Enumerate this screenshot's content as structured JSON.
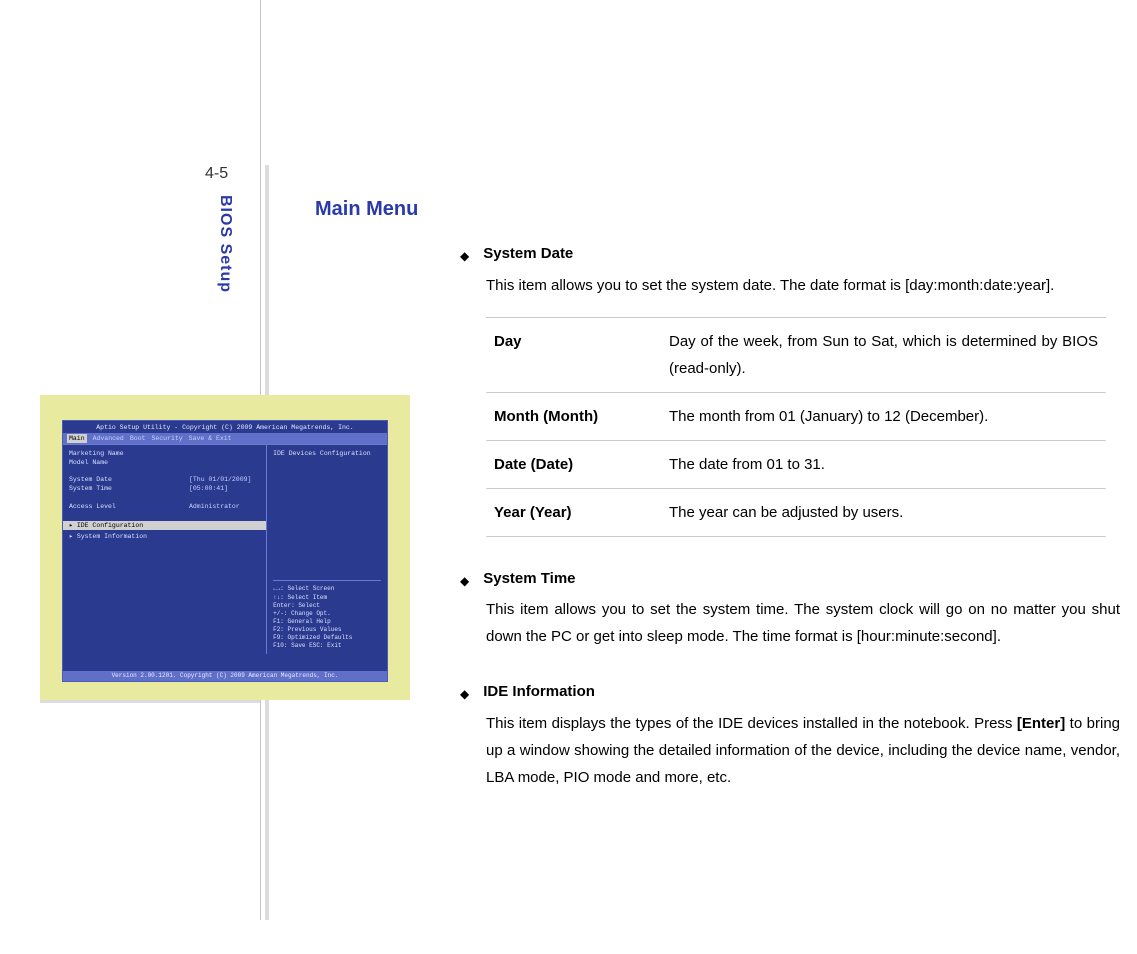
{
  "page_number": "4-5",
  "sidebar_label": "BIOS Setup",
  "heading": "Main Menu",
  "sections": {
    "system_date": {
      "title": "System Date",
      "body": "This item allows you to set the system date.   The date format is [day:month:date:year]."
    },
    "system_time": {
      "title": "System Time",
      "body": "This item allows you to set the system time.   The system clock will go on no matter you shut down the PC or get into sleep mode.   The time format is [hour:minute:second]."
    },
    "ide_info": {
      "title": "IDE Information",
      "body_pre": "This item displays the types of the IDE devices installed in the notebook. Press ",
      "body_bold": "[Enter]",
      "body_post": " to bring up a window showing the detailed information of the device, including the device name, vendor, LBA mode, PIO mode and more, etc."
    }
  },
  "date_rows": [
    {
      "term": "Day",
      "desc": "Day of the week, from Sun to Sat, which is determined by BIOS (read-only)."
    },
    {
      "term": "Month (Month)",
      "desc": "The month from 01 (January) to 12 (December)."
    },
    {
      "term": "Date (Date)",
      "desc": "The date from 01 to 31."
    },
    {
      "term": "Year (Year)",
      "desc": "The year can be adjusted by users."
    }
  ],
  "bios": {
    "title": "Aptio Setup Utility - Copyright (C) 2009 American Megatrends, Inc.",
    "tabs": [
      "Main",
      "Advanced",
      "Boot",
      "Security",
      "Save & Exit"
    ],
    "active_tab": "Main",
    "left": {
      "marketing": "Marketing Name",
      "model": "Model Name",
      "date_lbl": "System Date",
      "date_val": "[Thu 01/01/2009]",
      "time_lbl": "System Time",
      "time_val": "[05:00:41]",
      "access_lbl": "Access Level",
      "access_val": "Administrator",
      "ide": "IDE Configuration",
      "sysinfo": "System Information"
    },
    "right_top": "IDE Devices Configuration",
    "help": [
      "←→: Select Screen",
      "↑↓: Select Item",
      "Enter: Select",
      "+/-: Change Opt.",
      "F1:  General Help",
      "F2:  Previous Values",
      "F9:  Optimized Defaults",
      "F10: Save  ESC: Exit"
    ],
    "footer": "Version 2.00.1201. Copyright (C) 2009 American Megatrends, Inc."
  }
}
